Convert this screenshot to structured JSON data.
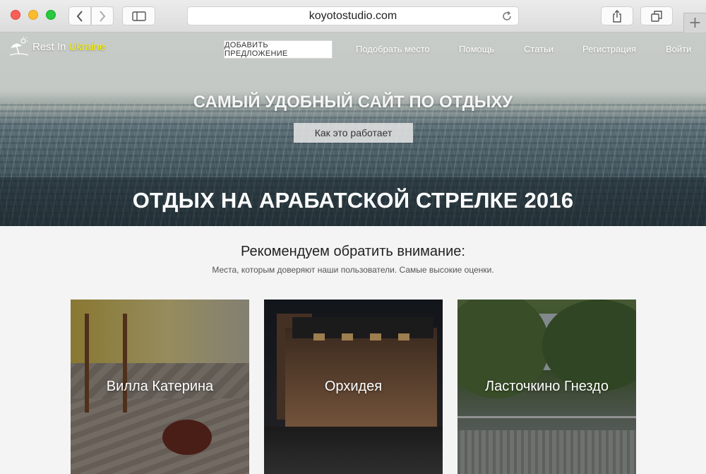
{
  "browser": {
    "url": "koyotostudio.com"
  },
  "site": {
    "logo_text": "Rest In",
    "logo_highlight": "Ukraine",
    "offer_button": "ДОБАВИТЬ ПРЕДЛОЖЕНИЕ",
    "nav": [
      {
        "label": "Подобрать место"
      },
      {
        "label": "Помощь"
      },
      {
        "label": "Статьи"
      },
      {
        "label": "Регистрация"
      },
      {
        "label": "Войти"
      }
    ]
  },
  "hero": {
    "title": "САМЫЙ УДОБНЫЙ САЙТ ПО ОТДЫХУ",
    "how_button": "Как это работает",
    "subtitle": "ОТДЫХ НА АРАБАТСКОЙ СТРЕЛКЕ 2016"
  },
  "recommend": {
    "title": "Рекомендуем обратить внимание:",
    "subtitle": "Места, которым доверяют наши пользователи. Самые высокие оценки.",
    "cards": [
      {
        "name": "Вилла Катерина"
      },
      {
        "name": "Орхидея"
      },
      {
        "name": "Ласточкино Гнездо"
      }
    ]
  }
}
